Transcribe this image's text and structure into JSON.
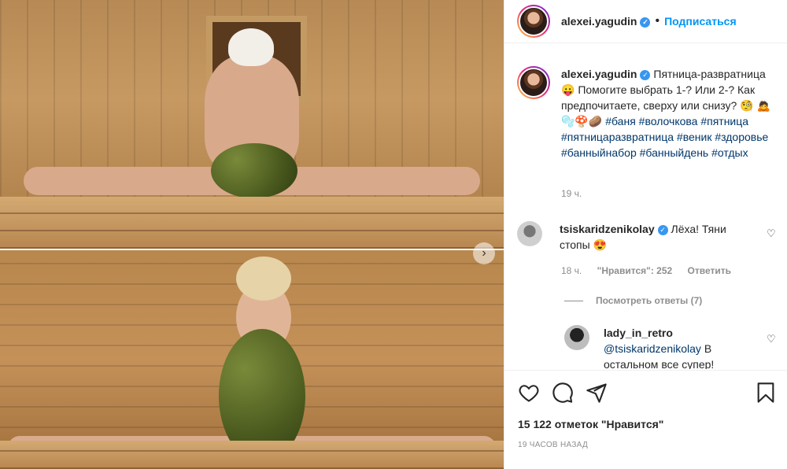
{
  "post": {
    "author": "alexei.yagudin",
    "follow_label": "Подписаться",
    "verified_icon": "verified-badge-icon"
  },
  "caption": {
    "username": "alexei.yagudin",
    "text_1": "Пятница-развратница",
    "emoji_1": "😛",
    "text_2": "Помогите выбрать 1-? Или 2-? Как предпочитаете, сверху или снизу?",
    "emoji_2": "🧐",
    "emoji_3": "🙇",
    "emoji_4": "🫧🍄🥔",
    "hashtags": [
      "#баня",
      "#волочкова",
      "#пятница",
      "#пятницаразвратница",
      "#веник",
      "#здоровье",
      "#банныйнабор",
      "#банныйдень",
      "#отдых"
    ],
    "time": "19 ч."
  },
  "comments": [
    {
      "username": "tsiskaridzenikolay",
      "text": "Лёха! Тяни стопы",
      "emoji": "😍",
      "time": "18 ч.",
      "likes": "\"Нравится\": 252",
      "reply_label": "Ответить",
      "view_replies": "Посмотреть ответы (7)"
    },
    {
      "username": "lady_in_retro",
      "mention": "@tsiskaridzenikolay",
      "text": "В остальном все супер!"
    }
  ],
  "footer": {
    "likes_text": "15 122 отметок \"Нравится\"",
    "posted_ago": "19 ЧАСОВ НАЗАД"
  },
  "icons": {
    "like": "heart-icon",
    "comment": "comment-icon",
    "share": "share-icon",
    "save": "bookmark-icon",
    "next": "chevron-right-icon"
  },
  "colors": {
    "accent": "#0095f6",
    "verified": "#3897f0",
    "hashtag": "#00376b",
    "muted": "#8e8e8e"
  }
}
